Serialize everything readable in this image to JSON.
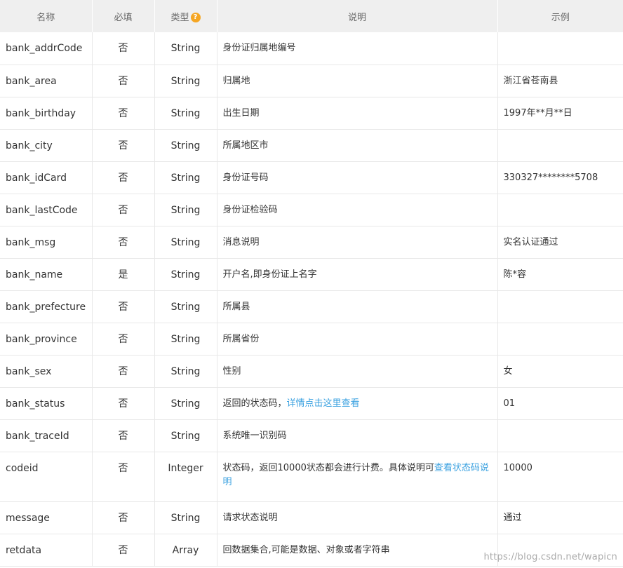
{
  "header": {
    "name": "名称",
    "required": "必填",
    "type": "类型",
    "type_help_glyph": "?",
    "description": "说明",
    "example": "示例"
  },
  "rows": [
    {
      "name": "bank_addrCode",
      "required": "否",
      "type": "String",
      "desc": "身份证归属地编号",
      "example": ""
    },
    {
      "name": "bank_area",
      "required": "否",
      "type": "String",
      "desc": "归属地",
      "example": "浙江省苍南县"
    },
    {
      "name": "bank_birthday",
      "required": "否",
      "type": "String",
      "desc": "出生日期",
      "example": "1997年**月**日"
    },
    {
      "name": "bank_city",
      "required": "否",
      "type": "String",
      "desc": "所属地区市",
      "example": ""
    },
    {
      "name": "bank_idCard",
      "required": "否",
      "type": "String",
      "desc": "身份证号码",
      "example": "330327********5708"
    },
    {
      "name": "bank_lastCode",
      "required": "否",
      "type": "String",
      "desc": "身份证检验码",
      "example": ""
    },
    {
      "name": "bank_msg",
      "required": "否",
      "type": "String",
      "desc": "消息说明",
      "example": "实名认证通过"
    },
    {
      "name": "bank_name",
      "required": "是",
      "type": "String",
      "desc": "开户名,即身份证上名字",
      "example": "陈*容"
    },
    {
      "name": "bank_prefecture",
      "required": "否",
      "type": "String",
      "desc": "所属县",
      "example": ""
    },
    {
      "name": "bank_province",
      "required": "否",
      "type": "String",
      "desc": "所属省份",
      "example": ""
    },
    {
      "name": "bank_sex",
      "required": "否",
      "type": "String",
      "desc": "性别",
      "example": "女"
    },
    {
      "name": "bank_status",
      "required": "否",
      "type": "String",
      "desc": "返回的状态码，",
      "desc_link": "详情点击这里查看",
      "example": "01"
    },
    {
      "name": "bank_traceId",
      "required": "否",
      "type": "String",
      "desc": "系统唯一识别码",
      "example": ""
    },
    {
      "name": "codeid",
      "required": "否",
      "type": "Integer",
      "desc": "状态码，返回10000状态都会进行计费。具体说明可",
      "desc_link": "查看状态码说明",
      "example": "10000"
    },
    {
      "name": "message",
      "required": "否",
      "type": "String",
      "desc": "请求状态说明",
      "example": "通过"
    },
    {
      "name": "retdata",
      "required": "否",
      "type": "Array",
      "desc": "回数据集合,可能是数据、对象或者字符串",
      "example": ""
    }
  ],
  "watermark": "https://blog.csdn.net/wapicn",
  "colors": {
    "header_bg": "#efefef",
    "link": "#3aa1e0",
    "help_icon": "#f5a623",
    "border": "#e8e8e8"
  }
}
